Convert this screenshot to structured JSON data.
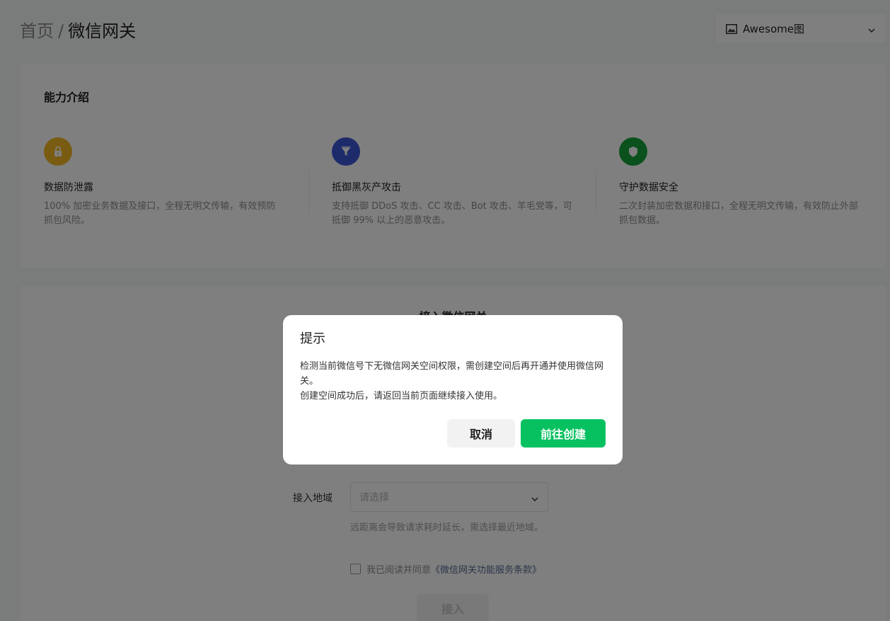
{
  "header": {
    "breadcrumb_home": "首页",
    "breadcrumb_sep": "/",
    "breadcrumb_current": "微信网关",
    "account": {
      "name": "Awesome图",
      "icon": "image-icon"
    }
  },
  "intro": {
    "title": "能力介绍",
    "features": [
      {
        "icon": "lock-icon",
        "color": "#f2b822",
        "name": "数据防泄露",
        "desc": "100% 加密业务数据及接口，全程无明文传输，有效预防抓包风险。"
      },
      {
        "icon": "filter-icon",
        "color": "#3d56d6",
        "name": "抵御黑灰产攻击",
        "desc": "支持抵御 DDoS 攻击、CC 攻击、Bot 攻击、羊毛党等，可抵御 99% 以上的恶意攻击。"
      },
      {
        "icon": "shield-icon",
        "color": "#16a33a",
        "name": "守护数据安全",
        "desc": "二次封装加密数据和接口，全程无明文传输，有效防止外部抓包数据。"
      }
    ]
  },
  "access": {
    "title": "接入微信网关",
    "region_label": "接入地域",
    "region_placeholder": "请选择",
    "region_hint": "远距离会导致请求耗时延长，需选择最近地域。",
    "agree_text": "我已阅读并同意",
    "agree_link": "《微信网关功能服务条款》",
    "submit_label": "接入"
  },
  "dialog": {
    "title": "提示",
    "message_line1": "检测当前微信号下无微信网关空间权限，需创建空间后再开通并使用微信网关。",
    "message_line2": "创建空间成功后，请返回当前页面继续接入使用。",
    "cancel_label": "取消",
    "confirm_label": "前往创建"
  },
  "colors": {
    "primary": "#07c160",
    "link": "#576b95"
  }
}
